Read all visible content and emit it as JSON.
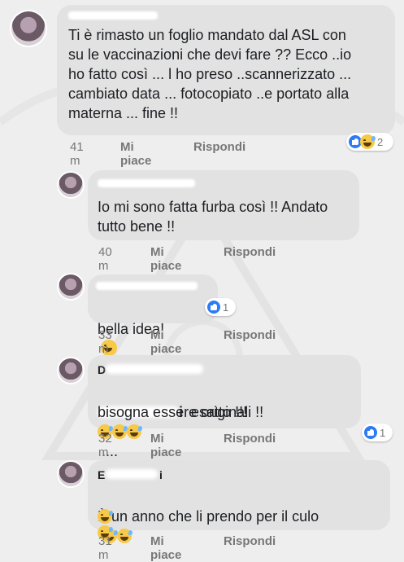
{
  "comments": [
    {
      "author": "",
      "text": "Ti è  rimasto un foglio mandato dal ASL con\nsu le vaccinazioni che devi fare ??  Ecco ..io\nho fatto così ... l ho preso ..scannerizzato  ...\ncambiato data ... fotocopiato  ..e portato alla\nmaterna ...  fine !!",
      "time": "41 m",
      "like_label": "Mi piace",
      "reply_label": "Rispondi",
      "reactions": [
        "like",
        "haha"
      ],
      "reaction_count": "2"
    },
    {
      "author": "",
      "text": "Io mi sono fatta furba così !! Andato\ntutto bene !!",
      "time": "40 m",
      "like_label": "Mi piace",
      "reply_label": "Rispondi"
    },
    {
      "author": "",
      "text": "bella idea!",
      "time": "33 m",
      "like_label": "Mi piace",
      "reply_label": "Rispondi",
      "reactions": [
        "like"
      ],
      "reaction_count": "1"
    },
    {
      "author": "D",
      "author_suffix": "i",
      "text_line1": "esatto !!!",
      "text_line1_tail": "....",
      "text_line2": "bisogna essere originali !!",
      "time": "32 m",
      "like_label": "Mi piace",
      "reply_label": "Rispondi",
      "reactions": [
        "like"
      ],
      "reaction_count": "1"
    },
    {
      "author": "E",
      "author_suffix": "i",
      "text": "È  un anno che li prendo per il culo",
      "time": "31 m",
      "like_label": "Mi piace",
      "reply_label": "Rispondi"
    }
  ],
  "icons": {
    "like": "thumbs-up",
    "haha": "laughing-with-tears"
  }
}
